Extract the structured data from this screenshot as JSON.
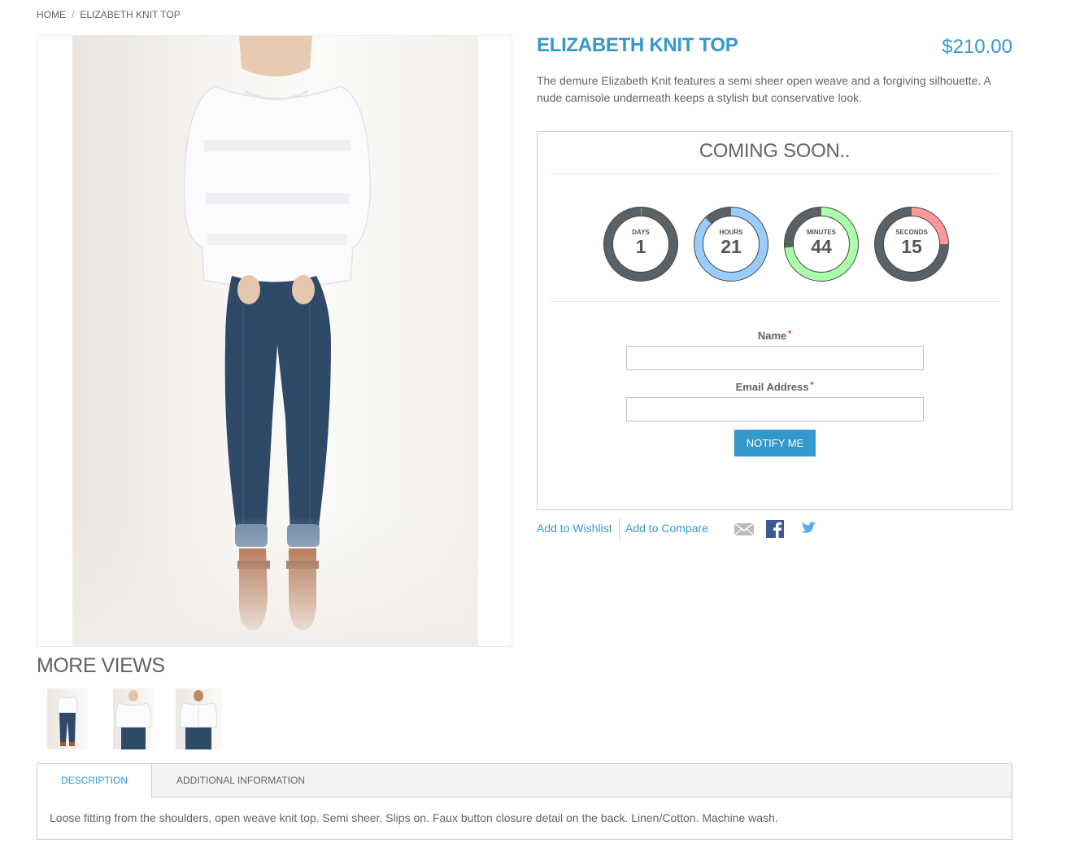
{
  "breadcrumb": {
    "home": "HOME",
    "separator": "/",
    "current": "ELIZABETH KNIT TOP"
  },
  "product": {
    "name": "ELIZABETH KNIT TOP",
    "price": "$210.00",
    "short_description": "The demure Elizabeth Knit features a semi sheer open weave and a forgiving silhouette. A nude camisole underneath keeps a stylish but conservative look."
  },
  "coming_soon": {
    "title": "COMING SOON..",
    "countdown": [
      {
        "unit": "DAYS",
        "value": "1",
        "fraction": 0.0,
        "color": "#99ccff"
      },
      {
        "unit": "HOURS",
        "value": "21",
        "fraction": 0.875,
        "color": "#99ccff"
      },
      {
        "unit": "MINUTES",
        "value": "44",
        "fraction": 0.733,
        "color": "#aaffaa"
      },
      {
        "unit": "SECONDS",
        "value": "15",
        "fraction": 0.25,
        "color": "#ff9999"
      }
    ],
    "track_color": "#5a6268",
    "form": {
      "name_label": "Name",
      "email_label": "Email Address",
      "required_mark": "*",
      "name_value": "",
      "email_value": "",
      "button_label": "NOTIFY ME"
    }
  },
  "actions": {
    "wishlist": "Add to Wishlist",
    "compare": "Add to Compare",
    "share_icons": [
      "email-icon",
      "facebook-icon",
      "twitter-icon"
    ]
  },
  "more_views": {
    "title": "MORE VIEWS",
    "thumbnails": [
      "front-full-view",
      "front-close-view",
      "back-view"
    ]
  },
  "tabs": {
    "items": [
      "DESCRIPTION",
      "ADDITIONAL INFORMATION"
    ],
    "active": "DESCRIPTION",
    "content": "Loose fitting from the shoulders, open weave knit top. Semi sheer. Slips on. Faux button closure detail on the back. Linen/Cotton. Machine wash."
  },
  "colors": {
    "accent": "#3399cc",
    "text": "#636363",
    "required": "#df280a"
  }
}
